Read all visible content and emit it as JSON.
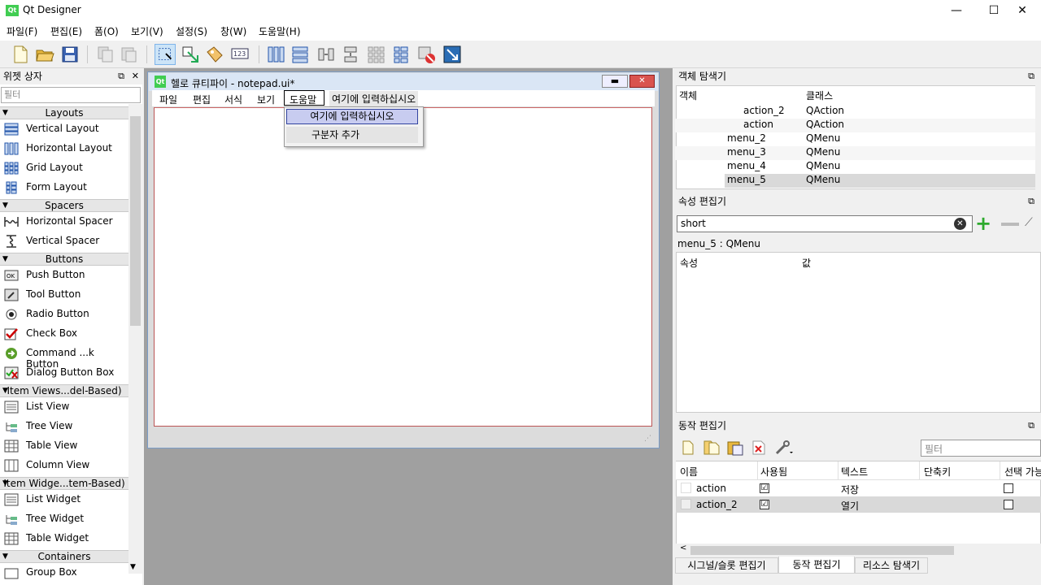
{
  "window": {
    "title": "Qt Designer",
    "icon_text": "Qt",
    "minimize": "—",
    "maximize": "☐",
    "close": "✕"
  },
  "menubar": [
    "파일(F)",
    "편집(E)",
    "폼(O)",
    "보기(V)",
    "설정(S)",
    "창(W)",
    "도움말(H)"
  ],
  "widget_box": {
    "title": "위젯 상자",
    "filter_placeholder": "필터",
    "categories": {
      "layouts": "Layouts",
      "spacers": "Spacers",
      "buttons": "Buttons",
      "item_views": "Item Views...del-Based)",
      "item_widgets": "Item Widge...tem-Based)",
      "containers": "Containers"
    },
    "items": {
      "vertical_layout": "Vertical Layout",
      "horizontal_layout": "Horizontal Layout",
      "grid_layout": "Grid Layout",
      "form_layout": "Form Layout",
      "horizontal_spacer": "Horizontal Spacer",
      "vertical_spacer": "Vertical Spacer",
      "push_button": "Push Button",
      "tool_button": "Tool Button",
      "radio_button": "Radio Button",
      "check_box": "Check Box",
      "command_button": "Command ...k Button",
      "dialog_button_box": "Dialog Button Box",
      "list_view": "List View",
      "tree_view": "Tree View",
      "table_view": "Table View",
      "column_view": "Column View",
      "list_widget": "List Widget",
      "tree_widget": "Tree Widget",
      "table_widget": "Table Widget",
      "group_box": "Group Box"
    }
  },
  "form": {
    "title": "헬로 큐티파이 - notepad.ui*",
    "icon_text": "Qt",
    "menus": [
      "파일",
      "편집",
      "서식",
      "보기",
      "도움말",
      "여기에 입력하십시오"
    ],
    "popup_items": [
      "여기에 입력하십시오",
      "구분자 추가"
    ]
  },
  "object_inspector": {
    "title": "객체 탐색기",
    "col_object": "객체",
    "col_class": "클래스",
    "rows": [
      {
        "name": "action_2",
        "cls": "QAction"
      },
      {
        "name": "action",
        "cls": "QAction"
      },
      {
        "name": "menu_2",
        "cls": "QMenu"
      },
      {
        "name": "menu_3",
        "cls": "QMenu"
      },
      {
        "name": "menu_4",
        "cls": "QMenu"
      },
      {
        "name": "menu_5",
        "cls": "QMenu"
      }
    ]
  },
  "property_editor": {
    "title": "속성 편집기",
    "filter_value": "short",
    "object_label": "menu_5 : QMenu",
    "col_property": "속성",
    "col_value": "값"
  },
  "action_editor": {
    "title": "동작 편집기",
    "filter_placeholder": "필터",
    "columns": [
      "이름",
      "사용됨",
      "텍스트",
      "단축키",
      "선택 가능"
    ],
    "rows": [
      {
        "name": "action",
        "used": "☑",
        "text": "저장",
        "checkable": ""
      },
      {
        "name": "action_2",
        "used": "☑",
        "text": "열기",
        "checkable": ""
      }
    ]
  },
  "bottom_tabs": [
    "시그널/슬롯 편집기",
    "동작 편집기",
    "리소스 탐색기"
  ],
  "colors": {
    "accent": "#3399ff",
    "selection": "#cce8ff",
    "form_border": "#7a9cc8"
  }
}
